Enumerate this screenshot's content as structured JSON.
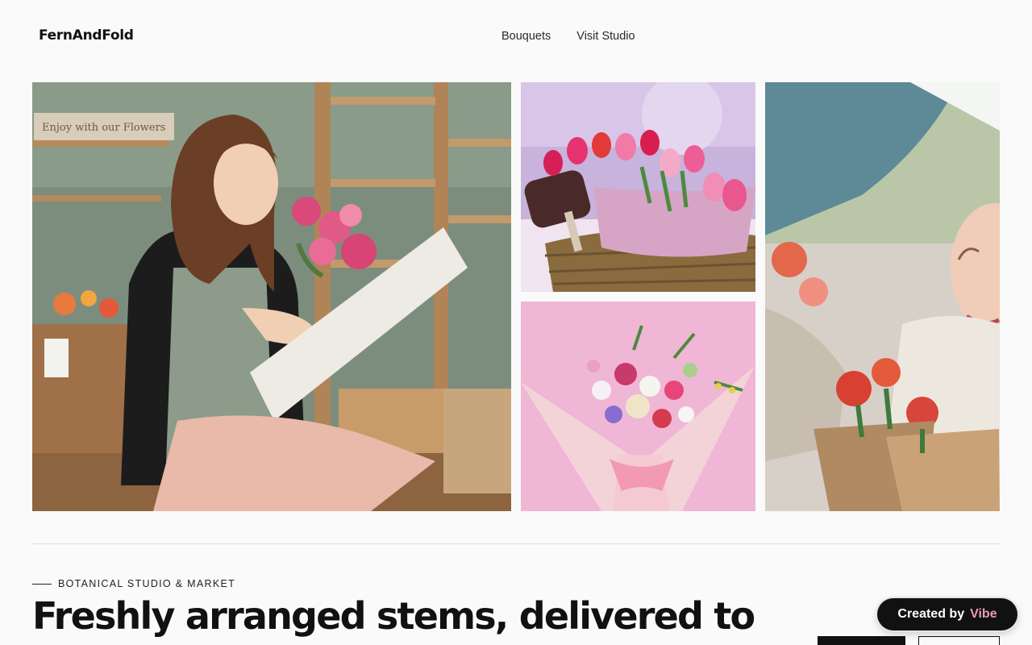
{
  "header": {
    "logo": "FernAndFold",
    "nav": [
      {
        "label": "Bouquets"
      },
      {
        "label": "Visit Studio"
      }
    ]
  },
  "gallery": {
    "photos": [
      {
        "subject": "florist wrapping pink roses at studio counter",
        "sign_text": "Enjoy with our Flowers"
      },
      {
        "subject": "pink and red tulips in wicker basket"
      },
      {
        "subject": "mixed bouquet wrapped in pink paper"
      },
      {
        "subject": "smiling woman holding wrapped tulips"
      }
    ]
  },
  "hero": {
    "eyebrow": "BOTANICAL STUDIO & MARKET",
    "headline": "Freshly arranged stems, delivered to"
  },
  "badge": {
    "prefix": "Created by",
    "brand": "Vibe"
  },
  "colors": {
    "background": "#fafafa",
    "text": "#111111",
    "badge_bg": "#111111",
    "badge_brand": "#e59fb3"
  }
}
